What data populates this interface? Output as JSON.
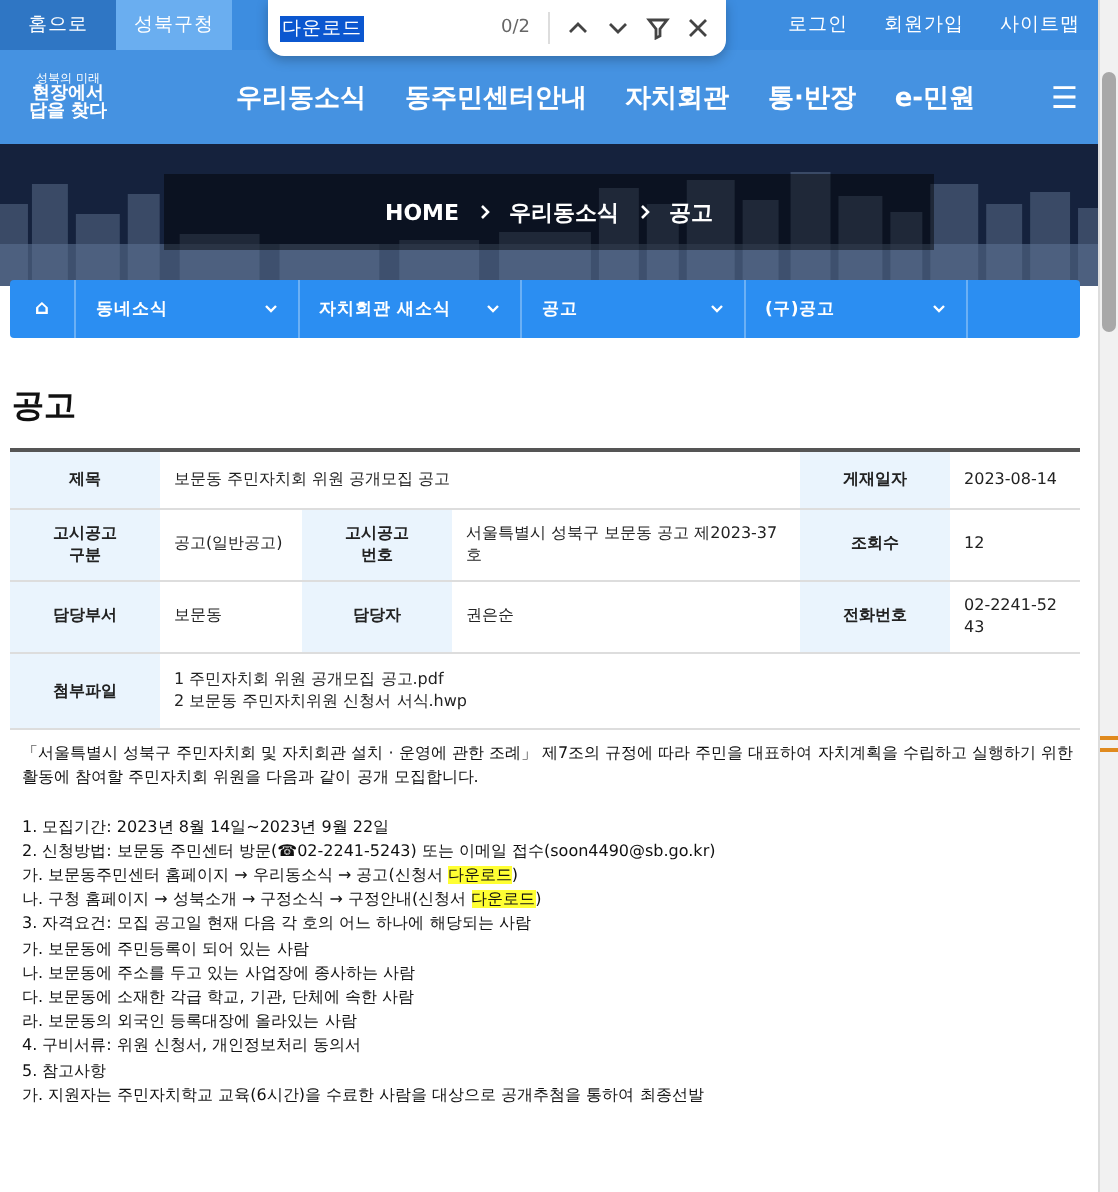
{
  "top_bar": {
    "tabs": [
      {
        "label": "홈으로",
        "selected": true
      },
      {
        "label": "성북구청",
        "selected": false
      }
    ],
    "links": [
      "로그인",
      "회원가입",
      "사이트맵"
    ]
  },
  "find_bar": {
    "query": "다운로드",
    "count": "0/2"
  },
  "main_nav": {
    "logo": {
      "small": "성북의 미래",
      "lines": [
        "현장에서",
        "답을 찾다"
      ]
    },
    "items": [
      "우리동소식",
      "동주민센터안내",
      "자치회관",
      "통·반장",
      "e-민원"
    ],
    "menu_glyph": "☰"
  },
  "breadcrumb": [
    "HOME",
    "우리동소식",
    "공고"
  ],
  "sub_nav": {
    "home_glyph": "⌂",
    "items": [
      "동네소식",
      "자치회관 새소식",
      "공고",
      "(구)공고"
    ]
  },
  "page_title": "공고",
  "table": {
    "title_row": [
      {
        "label": "제목",
        "value": "보문동 주민자치회 위원 공개모집 공고"
      },
      {
        "label": "게재일자",
        "value": "2023-08-14"
      }
    ],
    "rows": [
      [
        {
          "label": "고시공고 구분",
          "value": "공고(일반공고)"
        },
        {
          "label": "고시공고 번호",
          "value": "서울특별시 성북구 보문동 공고 제2023-37호"
        },
        {
          "label": "조회수",
          "value": "12"
        }
      ],
      [
        {
          "label": "담당부서",
          "value": "보문동"
        },
        {
          "label": "담당자",
          "value": "권은순"
        },
        {
          "label": "전화번호",
          "value": "02-2241-5243"
        }
      ]
    ],
    "attachments": {
      "label": "첨부파일",
      "files": [
        "1 주민자치회 위원 공개모집 공고.pdf",
        "2 보문동 주민자치위원 신청서 서식.hwp"
      ]
    }
  },
  "body": [
    [
      {
        "text": "「서울특별시 성북구 주민자치회 및 자치회관 설치 · 운영에 관한 조례」 제7조의 규정에 따라 주민을 대표하여 자치계획을 수립하고 실행하기 위한 활동에 참여할 주민자치회 위원을 다음과 같이 공개 모집합니다.",
        "highlight": false
      }
    ],
    [
      {
        "text": "1. 모집기간: 2023년 8월 14일~2023년 9월 22일",
        "highlight": false
      }
    ],
    [
      {
        "text": "2. 신청방법: 보문동 주민센터 방문(☎02-2241-5243) 또는 이메일 접수(soon4490@sb.go.kr)",
        "highlight": false
      }
    ],
    [
      {
        "text": "가. 보문동주민센터 홈페이지 → 우리동소식 → 공고(신청서 ",
        "highlight": false
      },
      {
        "text": "다운로드",
        "highlight": true
      },
      {
        "text": ")",
        "highlight": false
      }
    ],
    [
      {
        "text": "나. 구청 홈페이지 → 성북소개 → 구정소식 → 구정안내(신청서 ",
        "highlight": false
      },
      {
        "text": "다운로드",
        "highlight": true
      },
      {
        "text": ")",
        "highlight": false
      }
    ],
    [
      {
        "text": "3. 자격요건: 모집 공고일 현재 다음 각 호의 어느 하나에 해당되는 사람",
        "highlight": false
      }
    ],
    [
      {
        "text": "가. 보문동에 주민등록이 되어 있는 사람",
        "highlight": false
      }
    ],
    [
      {
        "text": "나. 보문동에 주소를 두고 있는 사업장에 종사하는 사람",
        "highlight": false
      }
    ],
    [
      {
        "text": "다. 보문동에 소재한 각급 학교, 기관, 단체에 속한 사람",
        "highlight": false
      }
    ],
    [
      {
        "text": "라. 보문동의 외국인 등록대장에 올라있는 사람",
        "highlight": false
      }
    ],
    [
      {
        "text": "4. 구비서류: 위원 신청서, 개인정보처리 동의서",
        "highlight": false
      }
    ],
    [
      {
        "text": "5. 참고사항",
        "highlight": false
      }
    ],
    [
      {
        "text": "가. 지원자는 주민자치학교 교육(6시간)을 수료한 사람을 대상으로 공개추첨을 통하여 최종선발",
        "highlight": false
      }
    ]
  ]
}
